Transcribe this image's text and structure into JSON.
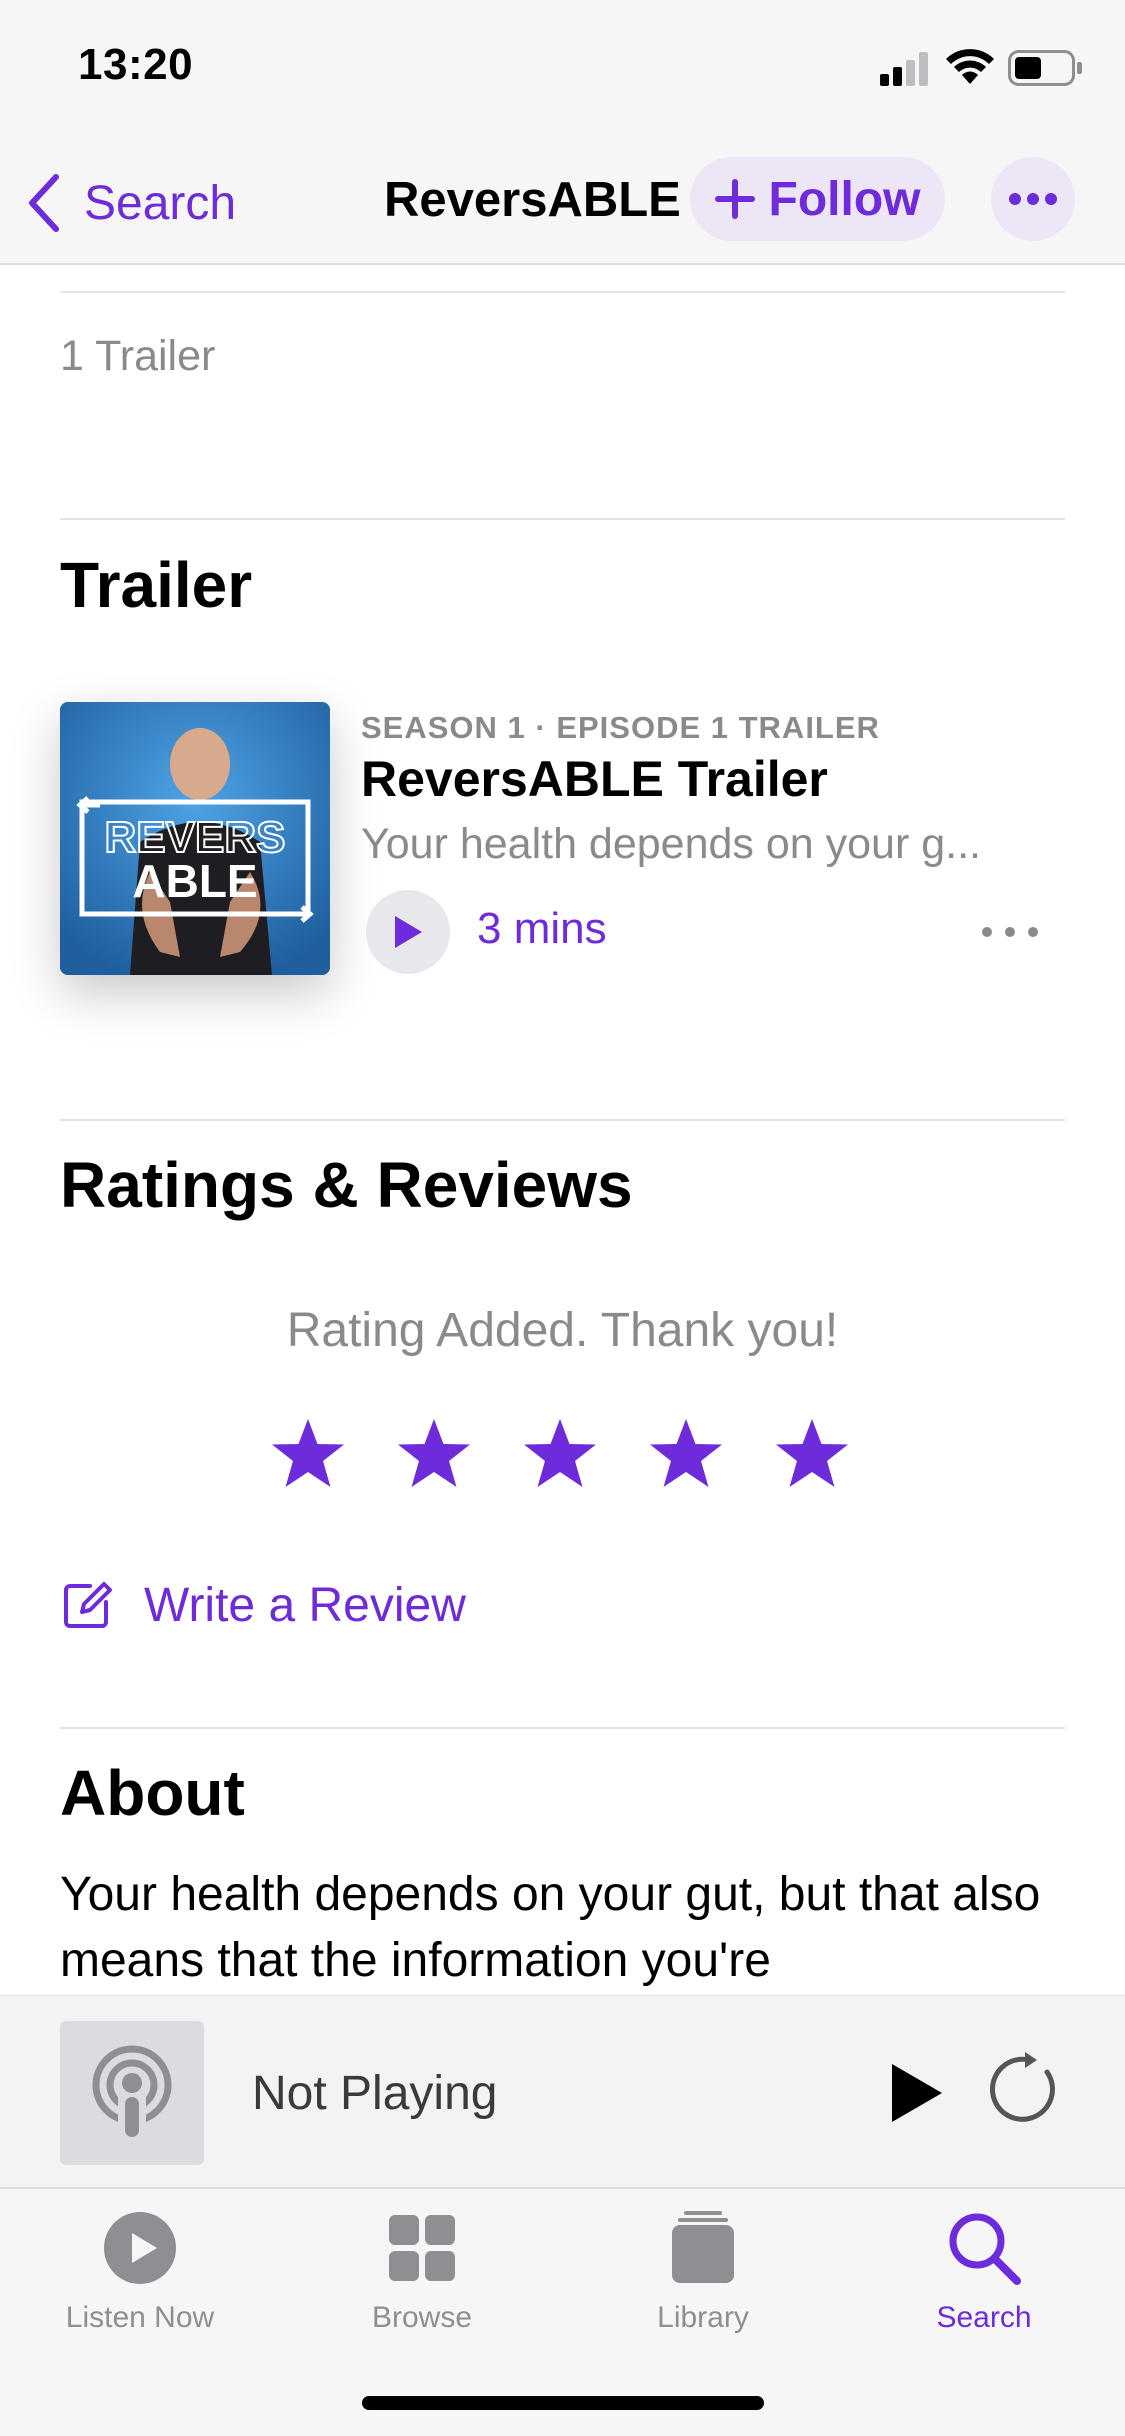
{
  "status_bar": {
    "time": "13:20"
  },
  "nav": {
    "back_label": "Search",
    "title": "ReversABLE",
    "follow_label": "Follow"
  },
  "meta": {
    "trailer_count": "1 Trailer"
  },
  "trailer_section": {
    "title": "Trailer",
    "episode": {
      "kicker": "SEASON 1 · EPISODE 1 TRAILER",
      "title": "ReversABLE Trailer",
      "description": "Your health depends on your g...",
      "duration": "3 mins",
      "artwork_text_top": "REVERS",
      "artwork_text_bottom": "ABLE"
    }
  },
  "ratings_section": {
    "title": "Ratings & Reviews",
    "message": "Rating Added. Thank you!",
    "rating": 5,
    "max_rating": 5,
    "write_review_label": "Write a Review"
  },
  "about_section": {
    "title": "About",
    "text": "Your health depends on your gut, but that also means that the information you're"
  },
  "mini_player": {
    "title": "Not Playing"
  },
  "tab_bar": {
    "tabs": [
      {
        "label": "Listen Now",
        "icon": "listen-now-icon",
        "active": false
      },
      {
        "label": "Browse",
        "icon": "browse-icon",
        "active": false
      },
      {
        "label": "Library",
        "icon": "library-icon",
        "active": false
      },
      {
        "label": "Search",
        "icon": "search-icon",
        "active": true
      }
    ]
  },
  "colors": {
    "accent": "#6d2bd9",
    "secondary_text": "#8a8a8e",
    "artwork_bg": "#2f7dc4"
  }
}
